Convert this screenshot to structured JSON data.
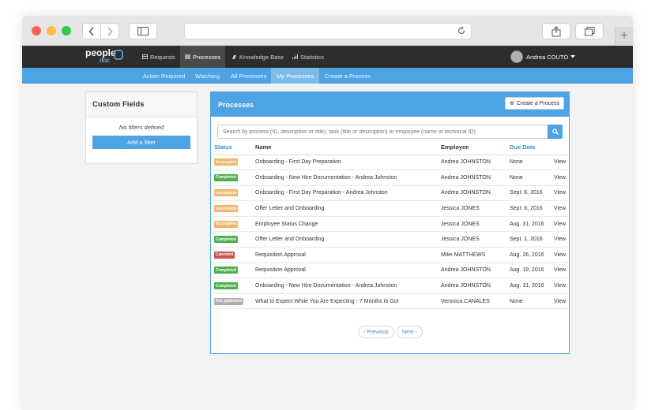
{
  "app": {
    "logo_main": "people",
    "logo_sub": "doc"
  },
  "topnav": {
    "items": [
      {
        "label": "Requests",
        "icon": "requests-icon"
      },
      {
        "label": "Processes",
        "icon": "list-icon"
      },
      {
        "label": "Knowledge Base",
        "icon": "book-icon"
      },
      {
        "label": "Statistics",
        "icon": "bar-chart-icon"
      }
    ],
    "active": "Processes",
    "user_name": "Andrea COUTO"
  },
  "subnav": {
    "items": [
      "Action Required",
      "Watching",
      "All Processes",
      "My Processes",
      "Create a Process"
    ],
    "active": "My Processes"
  },
  "sidebar": {
    "title": "Custom Fields",
    "no_filters_text": "No filters defined",
    "add_filter_label": "Add a filter"
  },
  "processes": {
    "title": "Processes",
    "create_label": "Create a Process",
    "search_placeholder": "Search by process (ID, description or title), task (title or description) or employee (name or technical ID)",
    "columns": {
      "status": "Status",
      "name": "Name",
      "employee": "Employee",
      "due_date": "Due Date"
    },
    "view_label": "View",
    "rows": [
      {
        "status": "Incomplete",
        "name": "Onboarding - First Day Preparation",
        "employee": "Andrea JOHNSTON",
        "due": "None"
      },
      {
        "status": "Completed",
        "name": "Onboarding - New Hire Documentation - Andrea Johnston",
        "employee": "Andrea JOHNSTON",
        "due": "None"
      },
      {
        "status": "Incomplete",
        "name": "Onboarding - First Day Preparation - Andrea Johnston",
        "employee": "Andrea JOHNSTON",
        "due": "Sept. 6, 2016"
      },
      {
        "status": "Incomplete",
        "name": "Offer Letter and Onboarding",
        "employee": "Jessica JONES",
        "due": "Sept. 6, 2016"
      },
      {
        "status": "Incomplete",
        "name": "Employee Status Change",
        "employee": "Jessica JONES",
        "due": "Aug. 31, 2016"
      },
      {
        "status": "Completed",
        "name": "Offer Letter and Onboarding",
        "employee": "Jessica JONES",
        "due": "Sept. 1, 2016"
      },
      {
        "status": "Canceled",
        "name": "Requisition Approval",
        "employee": "Mike MATTHEWS",
        "due": "Aug. 26, 2016"
      },
      {
        "status": "Completed",
        "name": "Requisition Approval",
        "employee": "Andrea JOHNSTON",
        "due": "Aug. 19, 2016"
      },
      {
        "status": "Completed",
        "name": "Onboarding - New Hire Documentation - Andrea Johnston",
        "employee": "Andrea JOHNSTON",
        "due": "Aug. 31, 2016"
      },
      {
        "status": "Not published",
        "name": "What to Expect While You Are Expecting - 7 Months to Go!",
        "employee": "Veronica CANALES",
        "due": "None"
      }
    ],
    "prev_label": "‹ Previous",
    "next_label": "Next ›"
  },
  "colors": {
    "accent": "#4da3e3",
    "nav_dark": "#2d2d2d",
    "status_incomplete": "#f0b66b",
    "status_completed": "#4cae4c",
    "status_canceled": "#c9534f",
    "status_not_published": "#b0b0b0"
  }
}
